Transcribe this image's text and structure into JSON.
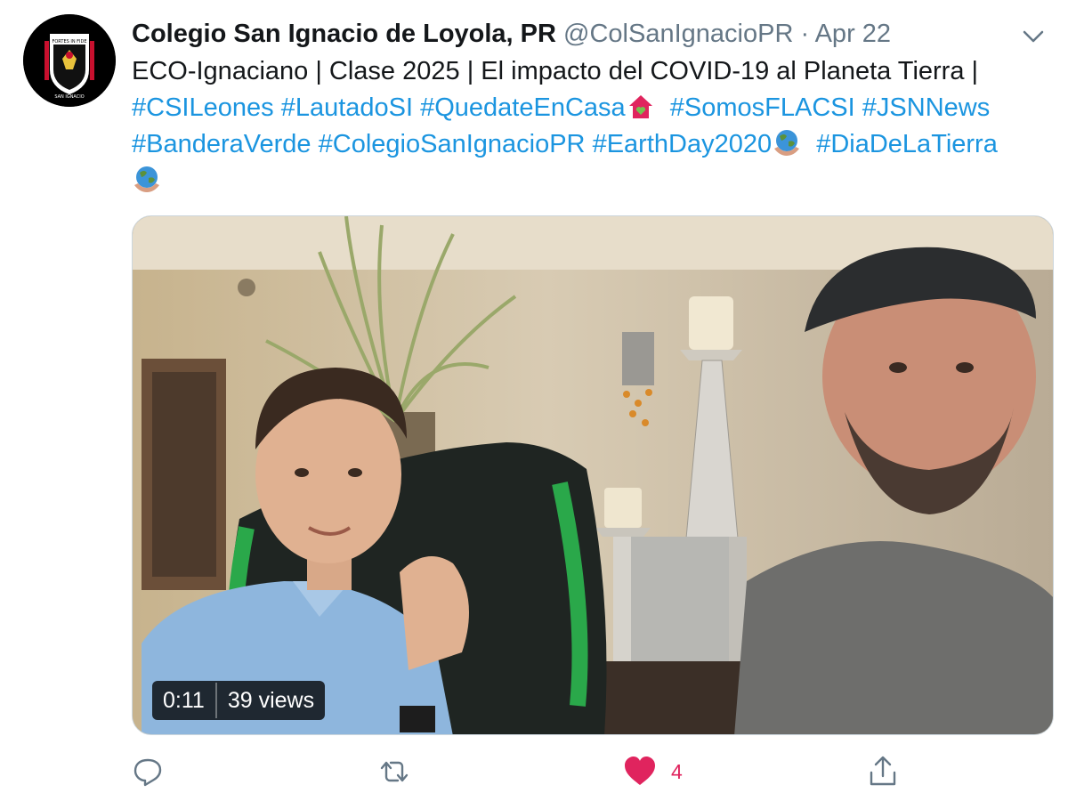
{
  "tweet": {
    "author_name": "Colegio San Ignacio de Loyola, PR",
    "handle": "@ColSanIgnacioPR",
    "separator": "·",
    "date": "Apr 22",
    "text_line": "ECO-Ignaciano | Clase 2025 | El impacto del COVID-19 al Planeta Tierra |",
    "hashtags": {
      "h1": "#CSILeones",
      "h2": "#LautadoSI",
      "h3": "#QuedateEnCasa",
      "h4": "#SomosFLACSI",
      "h5": "#JSNNews",
      "h6": "#BanderaVerde",
      "h7": "#ColegioSanIgnacioPR",
      "h8": "#EarthDay2020",
      "h9": "#DiaDeLaTierra"
    },
    "emojis": [
      "house-with-heart-emoji",
      "earth-globe-hands-emoji",
      "earth-globe-hands-emoji"
    ]
  },
  "avatar": {
    "logo_text_top": "FORTES IN FIDE",
    "logo_text_bottom": "SAN IGNACIO"
  },
  "video": {
    "duration": "0:11",
    "views": "39 views"
  },
  "actions": {
    "reply_icon": "reply-icon",
    "retweet_icon": "retweet-icon",
    "like_icon": "heart-icon",
    "like_count": "4",
    "share_icon": "share-icon"
  },
  "colors": {
    "link": "#1b95e0",
    "muted": "#657786",
    "like": "#e0245e"
  }
}
